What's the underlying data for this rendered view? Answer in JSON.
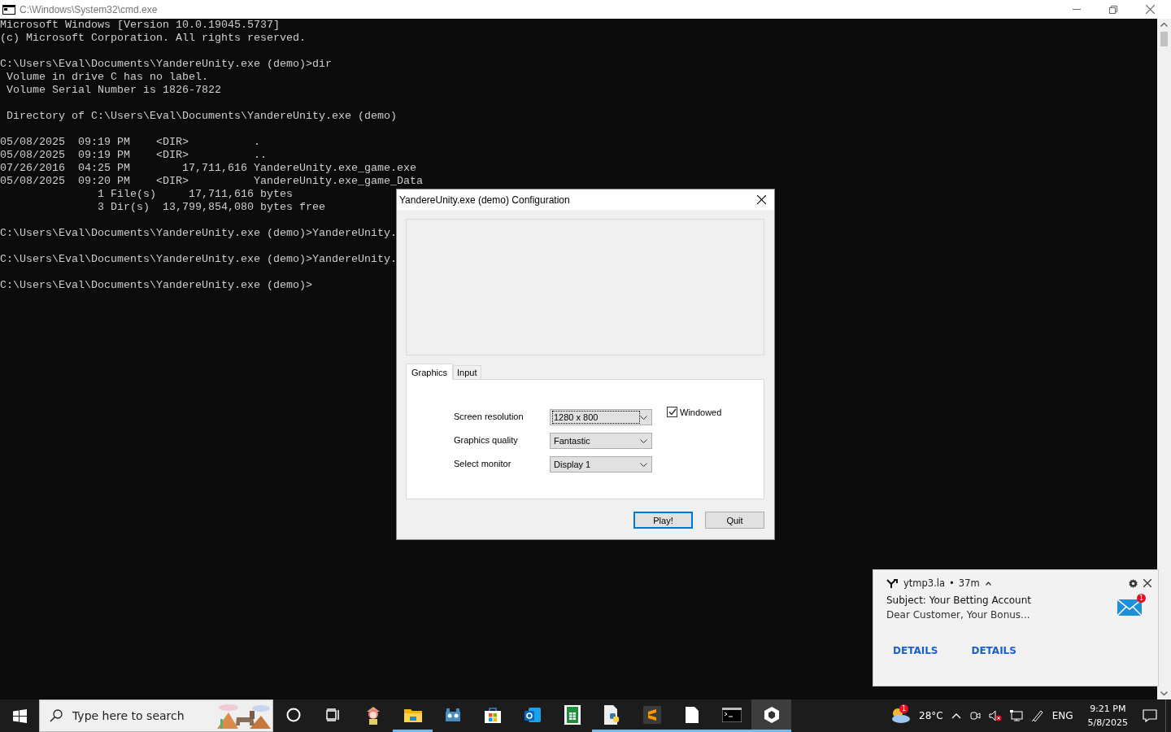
{
  "console_window": {
    "title": "C:\\Windows\\System32\\cmd.exe",
    "blocks": [
      [
        "Microsoft Windows [Version 10.0.19045.5737]",
        "(c) Microsoft Corporation. All rights reserved."
      ],
      [
        "C:\\Users\\Eval\\Documents\\YandereUnity.exe (demo)>dir",
        " Volume in drive C has no label.",
        " Volume Serial Number is 1826-7822"
      ],
      [
        " Directory of C:\\Users\\Eval\\Documents\\YandereUnity.exe (demo)"
      ],
      [
        "05/08/2025  09:19 PM    <DIR>          .",
        "05/08/2025  09:19 PM    <DIR>          ..",
        "07/26/2016  04:25 PM        17,711,616 YandereUnity.exe_game.exe",
        "05/08/2025  09:20 PM    <DIR>          YandereUnity.exe_game_Data",
        "               1 File(s)     17,711,616 bytes",
        "               3 Dir(s)  13,799,854,080 bytes free"
      ],
      [
        "C:\\Users\\Eval\\Documents\\YandereUnity.exe (demo)>YandereUnity."
      ],
      [
        "C:\\Users\\Eval\\Documents\\YandereUnity.exe (demo)>YandereUnity."
      ],
      [
        "C:\\Users\\Eval\\Documents\\YandereUnity.exe (demo)>"
      ]
    ]
  },
  "dialog": {
    "title": "YandereUnity.exe (demo) Configuration",
    "tabs": [
      {
        "label": "Graphics",
        "selected": true
      },
      {
        "label": "Input",
        "selected": false
      }
    ],
    "settings": [
      {
        "label": "Screen resolution",
        "value": "1280 x 800",
        "focused": true
      },
      {
        "label": "Graphics quality",
        "value": "Fantastic",
        "focused": false
      },
      {
        "label": "Select monitor",
        "value": "Display 1",
        "focused": false
      }
    ],
    "windowed": {
      "label": "Windowed",
      "checked": true
    },
    "buttons": [
      {
        "label": "Play!",
        "default": true
      },
      {
        "label": "Quit",
        "default": false
      }
    ]
  },
  "notification": {
    "app": "ytmp3.la",
    "separator": "•",
    "age": "37m",
    "subject": "Subject: Your Betting Account",
    "body": "Dear Customer, Your Bonus...",
    "badge": "1",
    "actions": [
      "DETAILS",
      "DETAILS"
    ]
  },
  "taskbar": {
    "search_placeholder": "Type here to search",
    "apps": [
      {
        "kind": "cortana",
        "running": false,
        "active": false
      },
      {
        "kind": "taskview",
        "running": false,
        "active": false
      },
      {
        "kind": "figure",
        "running": false,
        "active": false
      },
      {
        "kind": "folder",
        "running": true,
        "active": false
      },
      {
        "kind": "robot",
        "running": false,
        "active": false
      },
      {
        "kind": "store",
        "running": false,
        "active": false
      },
      {
        "kind": "mail",
        "running": false,
        "active": false
      },
      {
        "kind": "sheet",
        "running": false,
        "active": false
      },
      {
        "kind": "script",
        "running": true,
        "active": false
      },
      {
        "kind": "editor",
        "running": true,
        "active": false
      },
      {
        "kind": "file",
        "running": true,
        "active": false
      },
      {
        "kind": "terminal",
        "running": true,
        "active": false
      },
      {
        "kind": "unity",
        "running": true,
        "active": true
      }
    ],
    "weather_badge": "1",
    "temperature": "28°C",
    "language": "ENG",
    "time": "9:21 PM",
    "date": "5/8/2025"
  }
}
